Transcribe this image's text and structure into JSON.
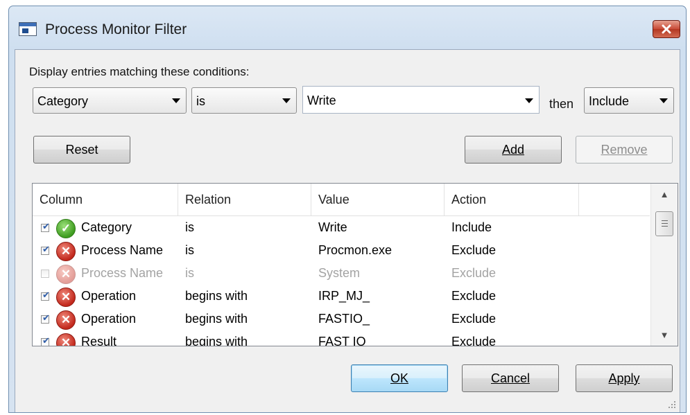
{
  "window": {
    "title": "Process Monitor Filter"
  },
  "filter": {
    "prompt": "Display entries matching these conditions:",
    "column_select": "Category",
    "relation_select": "is",
    "value_input": "Write",
    "then_label": "then",
    "action_select": "Include"
  },
  "buttons": {
    "reset": "Reset",
    "add": "Add",
    "remove": "Remove",
    "ok": "OK",
    "cancel": "Cancel",
    "apply": "Apply"
  },
  "list": {
    "headers": [
      "Column",
      "Relation",
      "Value",
      "Action"
    ],
    "rows": [
      {
        "enabled": true,
        "icon": "include-check-icon",
        "column": "Category",
        "relation": "is",
        "value": "Write",
        "action": "Include"
      },
      {
        "enabled": true,
        "icon": "exclude-x-icon",
        "column": "Process Name",
        "relation": "is",
        "value": "Procmon.exe",
        "action": "Exclude"
      },
      {
        "enabled": false,
        "icon": "exclude-x-icon",
        "column": "Process Name",
        "relation": "is",
        "value": "System",
        "action": "Exclude"
      },
      {
        "enabled": true,
        "icon": "exclude-x-icon",
        "column": "Operation",
        "relation": "begins with",
        "value": "IRP_MJ_",
        "action": "Exclude"
      },
      {
        "enabled": true,
        "icon": "exclude-x-icon",
        "column": "Operation",
        "relation": "begins with",
        "value": "FASTIO_",
        "action": "Exclude"
      },
      {
        "enabled": true,
        "icon": "exclude-x-icon",
        "column": "Result",
        "relation": "begins with",
        "value": "FAST IO",
        "action": "Exclude"
      }
    ]
  },
  "colors": {
    "include_icon": "#3e9c1f",
    "exclude_icon": "#c2281c",
    "close_button": "#c84a36"
  }
}
